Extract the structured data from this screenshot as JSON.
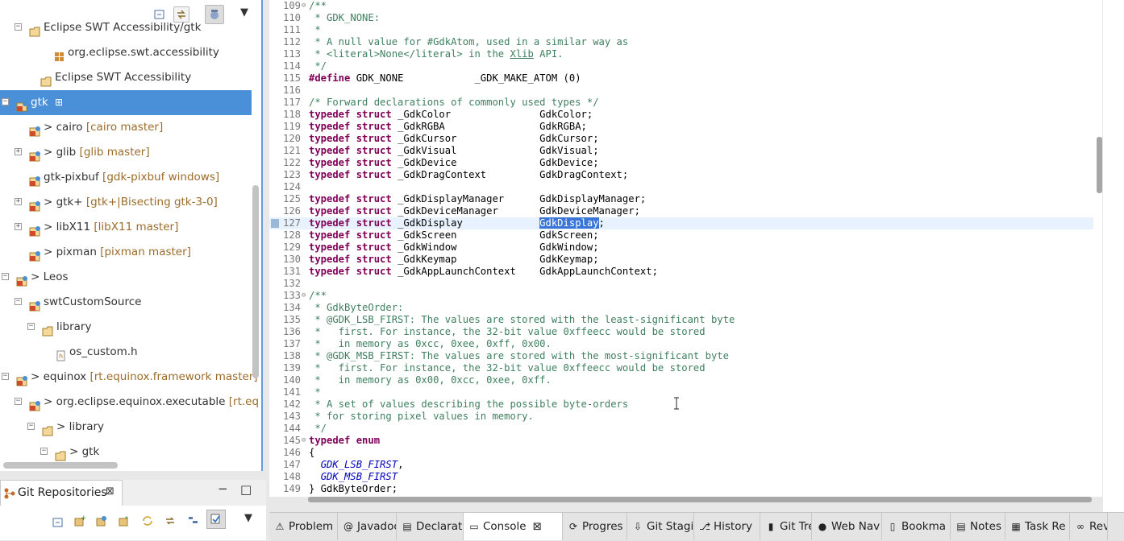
{
  "left_tree": {
    "items": [
      {
        "label": "Eclipse SWT Accessibility/gtk",
        "decoration": "",
        "indent": 36,
        "expander": "minus",
        "selected": false,
        "icon": "package-folder-icon"
      },
      {
        "label": "org.eclipse.swt.accessibility",
        "decoration": "",
        "indent": 66,
        "expander": "",
        "selected": false,
        "icon": "package-icon"
      },
      {
        "label": "Eclipse SWT Accessibility",
        "decoration": "",
        "indent": 50,
        "expander": "",
        "selected": false,
        "icon": "package-folder-icon"
      },
      {
        "label": "gtk",
        "decoration": "",
        "indent": 20,
        "expander": "minus",
        "selected": true,
        "icon": "git-project-icon"
      },
      {
        "label": "> cairo",
        "decoration": "[cairo master]",
        "indent": 36,
        "expander": "",
        "selected": false,
        "icon": "git-project-icon"
      },
      {
        "label": "> glib",
        "decoration": "[glib master]",
        "indent": 36,
        "expander": "plus",
        "selected": false,
        "icon": "git-project-icon"
      },
      {
        "label": "gtk-pixbuf",
        "decoration": "[gdk-pixbuf windows]",
        "indent": 36,
        "expander": "",
        "selected": false,
        "icon": "git-project-icon"
      },
      {
        "label": "> gtk+",
        "decoration": "[gtk+|Bisecting gtk-3-0]",
        "indent": 36,
        "expander": "plus",
        "selected": false,
        "icon": "git-project-icon"
      },
      {
        "label": "> libX11",
        "decoration": "[libX11 master]",
        "indent": 36,
        "expander": "plus",
        "selected": false,
        "icon": "git-project-icon"
      },
      {
        "label": "> pixman",
        "decoration": "[pixman master]",
        "indent": 36,
        "expander": "",
        "selected": false,
        "icon": "git-project-icon"
      },
      {
        "label": "> Leos",
        "decoration": "",
        "indent": 20,
        "expander": "minus",
        "selected": false,
        "icon": "git-project-icon"
      },
      {
        "label": "swtCustomSource",
        "decoration": "",
        "indent": 36,
        "expander": "minus",
        "selected": false,
        "icon": "git-project-icon"
      },
      {
        "label": "library",
        "decoration": "",
        "indent": 52,
        "expander": "minus",
        "selected": false,
        "icon": "package-folder-icon"
      },
      {
        "label": "os_custom.h",
        "decoration": "",
        "indent": 68,
        "expander": "",
        "selected": false,
        "icon": "header-file-icon"
      },
      {
        "label": "> equinox",
        "decoration": "[rt.equinox.framework master]",
        "indent": 20,
        "expander": "minus",
        "selected": false,
        "icon": "git-project-icon"
      },
      {
        "label": "> org.eclipse.equinox.executable",
        "decoration": "[rt.eq",
        "indent": 36,
        "expander": "minus",
        "selected": false,
        "icon": "git-project-icon"
      },
      {
        "label": "> library",
        "decoration": "",
        "indent": 52,
        "expander": "minus",
        "selected": false,
        "icon": "package-folder-icon"
      },
      {
        "label": "> gtk",
        "decoration": "",
        "indent": 68,
        "expander": "minus",
        "selected": false,
        "icon": "package-folder-icon"
      }
    ]
  },
  "git_pane": {
    "title": "Git Repositories",
    "close_glyph": "⊠",
    "minimize_glyph": "−",
    "maximize_glyph": "□",
    "menu_glyph": "▼"
  },
  "editor": {
    "current_line": "127",
    "lines": [
      {
        "n": "109",
        "fold": "⊖",
        "segs": [
          {
            "c": "cm",
            "t": "/**"
          }
        ]
      },
      {
        "n": "110",
        "fold": "",
        "segs": [
          {
            "c": "cm",
            "t": " * GDK_NONE:"
          }
        ]
      },
      {
        "n": "111",
        "fold": "",
        "segs": [
          {
            "c": "cm",
            "t": " *"
          }
        ]
      },
      {
        "n": "112",
        "fold": "",
        "segs": [
          {
            "c": "cm",
            "t": " * A null value for #GdkAtom, used in a similar way as"
          }
        ]
      },
      {
        "n": "113",
        "fold": "",
        "segs": [
          {
            "c": "cm",
            "t": " * <literal>None</literal> in the "
          },
          {
            "c": "cm ul",
            "t": "Xlib"
          },
          {
            "c": "cm",
            "t": " API."
          }
        ]
      },
      {
        "n": "114",
        "fold": "",
        "segs": [
          {
            "c": "cm",
            "t": " */"
          }
        ]
      },
      {
        "n": "115",
        "fold": "",
        "segs": [
          {
            "c": "kw",
            "t": "#define"
          },
          {
            "c": "",
            "t": " GDK_NONE            _GDK_MAKE_ATOM (0)"
          }
        ]
      },
      {
        "n": "116",
        "fold": "",
        "segs": [
          {
            "c": "",
            "t": ""
          }
        ]
      },
      {
        "n": "117",
        "fold": "",
        "segs": [
          {
            "c": "cm",
            "t": "/* Forward declarations of commonly used types */"
          }
        ]
      },
      {
        "n": "118",
        "fold": "",
        "segs": [
          {
            "c": "kw",
            "t": "typedef struct"
          },
          {
            "c": "",
            "t": " _GdkColor               GdkColor;"
          }
        ]
      },
      {
        "n": "119",
        "fold": "",
        "segs": [
          {
            "c": "kw",
            "t": "typedef struct"
          },
          {
            "c": "",
            "t": " _GdkRGBA                GdkRGBA;"
          }
        ]
      },
      {
        "n": "120",
        "fold": "",
        "segs": [
          {
            "c": "kw",
            "t": "typedef struct"
          },
          {
            "c": "",
            "t": " _GdkCursor              GdkCursor;"
          }
        ]
      },
      {
        "n": "121",
        "fold": "",
        "segs": [
          {
            "c": "kw",
            "t": "typedef struct"
          },
          {
            "c": "",
            "t": " _GdkVisual              GdkVisual;"
          }
        ]
      },
      {
        "n": "122",
        "fold": "",
        "segs": [
          {
            "c": "kw",
            "t": "typedef struct"
          },
          {
            "c": "",
            "t": " _GdkDevice              GdkDevice;"
          }
        ]
      },
      {
        "n": "123",
        "fold": "",
        "segs": [
          {
            "c": "kw",
            "t": "typedef struct"
          },
          {
            "c": "",
            "t": " _GdkDragContext         GdkDragContext;"
          }
        ]
      },
      {
        "n": "124",
        "fold": "",
        "segs": [
          {
            "c": "",
            "t": ""
          }
        ]
      },
      {
        "n": "125",
        "fold": "",
        "segs": [
          {
            "c": "kw",
            "t": "typedef struct"
          },
          {
            "c": "",
            "t": " _GdkDisplayManager      GdkDisplayManager;"
          }
        ]
      },
      {
        "n": "126",
        "fold": "",
        "segs": [
          {
            "c": "kw",
            "t": "typedef struct"
          },
          {
            "c": "",
            "t": " _GdkDeviceManager       GdkDeviceManager;"
          }
        ]
      },
      {
        "n": "127",
        "fold": "",
        "segs": [
          {
            "c": "kw",
            "t": "typedef struct"
          },
          {
            "c": "",
            "t": " _GdkDisplay             "
          },
          {
            "c": "sel",
            "t": "GdkDisplay"
          },
          {
            "c": "",
            "t": ";"
          }
        ]
      },
      {
        "n": "128",
        "fold": "",
        "segs": [
          {
            "c": "kw",
            "t": "typedef struct"
          },
          {
            "c": "",
            "t": " _GdkScreen              GdkScreen;"
          }
        ]
      },
      {
        "n": "129",
        "fold": "",
        "segs": [
          {
            "c": "kw",
            "t": "typedef struct"
          },
          {
            "c": "",
            "t": " _GdkWindow              GdkWindow;"
          }
        ]
      },
      {
        "n": "130",
        "fold": "",
        "segs": [
          {
            "c": "kw",
            "t": "typedef struct"
          },
          {
            "c": "",
            "t": " _GdkKeymap              GdkKeymap;"
          }
        ]
      },
      {
        "n": "131",
        "fold": "",
        "segs": [
          {
            "c": "kw",
            "t": "typedef struct"
          },
          {
            "c": "",
            "t": " _GdkAppLaunchContext    GdkAppLaunchContext;"
          }
        ]
      },
      {
        "n": "132",
        "fold": "",
        "segs": [
          {
            "c": "",
            "t": ""
          }
        ]
      },
      {
        "n": "133",
        "fold": "⊖",
        "segs": [
          {
            "c": "cm",
            "t": "/**"
          }
        ]
      },
      {
        "n": "134",
        "fold": "",
        "segs": [
          {
            "c": "cm",
            "t": " * GdkByteOrder:"
          }
        ]
      },
      {
        "n": "135",
        "fold": "",
        "segs": [
          {
            "c": "cm",
            "t": " * @GDK_LSB_FIRST: The values are stored with the least-significant byte"
          }
        ]
      },
      {
        "n": "136",
        "fold": "",
        "segs": [
          {
            "c": "cm",
            "t": " *   first. For instance, the 32-bit value 0xffeecc would be stored"
          }
        ]
      },
      {
        "n": "137",
        "fold": "",
        "segs": [
          {
            "c": "cm",
            "t": " *   in memory as 0xcc, 0xee, 0xff, 0x00."
          }
        ]
      },
      {
        "n": "138",
        "fold": "",
        "segs": [
          {
            "c": "cm",
            "t": " * @GDK_MSB_FIRST: The values are stored with the most-significant byte"
          }
        ]
      },
      {
        "n": "139",
        "fold": "",
        "segs": [
          {
            "c": "cm",
            "t": " *   first. For instance, the 32-bit value 0xffeecc would be stored"
          }
        ]
      },
      {
        "n": "140",
        "fold": "",
        "segs": [
          {
            "c": "cm",
            "t": " *   in memory as 0x00, 0xcc, 0xee, 0xff."
          }
        ]
      },
      {
        "n": "141",
        "fold": "",
        "segs": [
          {
            "c": "cm",
            "t": " *"
          }
        ]
      },
      {
        "n": "142",
        "fold": "",
        "segs": [
          {
            "c": "cm",
            "t": " * A set of values describing the possible byte-orders"
          }
        ]
      },
      {
        "n": "143",
        "fold": "",
        "segs": [
          {
            "c": "cm",
            "t": " * for storing pixel values in memory."
          }
        ]
      },
      {
        "n": "144",
        "fold": "",
        "segs": [
          {
            "c": "cm",
            "t": " */"
          }
        ]
      },
      {
        "n": "145",
        "fold": "⊖",
        "segs": [
          {
            "c": "kw",
            "t": "typedef enum"
          }
        ]
      },
      {
        "n": "146",
        "fold": "",
        "segs": [
          {
            "c": "",
            "t": "{"
          }
        ]
      },
      {
        "n": "147",
        "fold": "",
        "segs": [
          {
            "c": "",
            "t": "  "
          },
          {
            "c": "ec",
            "t": "GDK_LSB_FIRST"
          },
          {
            "c": "",
            "t": ","
          }
        ]
      },
      {
        "n": "148",
        "fold": "",
        "segs": [
          {
            "c": "",
            "t": "  "
          },
          {
            "c": "ec",
            "t": "GDK_MSB_FIRST"
          }
        ]
      },
      {
        "n": "149",
        "fold": "",
        "segs": [
          {
            "c": "",
            "t": "} GdkByteOrder;"
          }
        ]
      }
    ]
  },
  "bottom_tabs": [
    {
      "label": "Problem",
      "icon": "⚠",
      "active": false,
      "close": ""
    },
    {
      "label": "Javadoc",
      "icon": "@",
      "active": false,
      "close": ""
    },
    {
      "label": "Declarat",
      "icon": "▤",
      "active": false,
      "close": ""
    },
    {
      "label": "Console",
      "icon": "▭",
      "active": true,
      "close": "⊠"
    },
    {
      "label": "Progres",
      "icon": "⟳",
      "active": false,
      "close": ""
    },
    {
      "label": "Git Stagi",
      "icon": "⇩",
      "active": false,
      "close": ""
    },
    {
      "label": "History",
      "icon": "⎇",
      "active": false,
      "close": ""
    },
    {
      "label": "Git Tree",
      "icon": "▮",
      "active": false,
      "close": ""
    },
    {
      "label": "Web Nav",
      "icon": "●",
      "active": false,
      "close": ""
    },
    {
      "label": "Bookma",
      "icon": "▯",
      "active": false,
      "close": ""
    },
    {
      "label": "Notes",
      "icon": "▤",
      "active": false,
      "close": ""
    },
    {
      "label": "Task Re",
      "icon": "▦",
      "active": false,
      "close": ""
    },
    {
      "label": "Rev",
      "icon": "∞",
      "active": false,
      "close": ""
    }
  ],
  "colors": {
    "selection_blue": "#4a90d9",
    "comment_green": "#3f7f5f",
    "keyword_purple": "#7f0055",
    "enum_blue": "#0000c0",
    "decoration_brown": "#9c6c2a"
  }
}
